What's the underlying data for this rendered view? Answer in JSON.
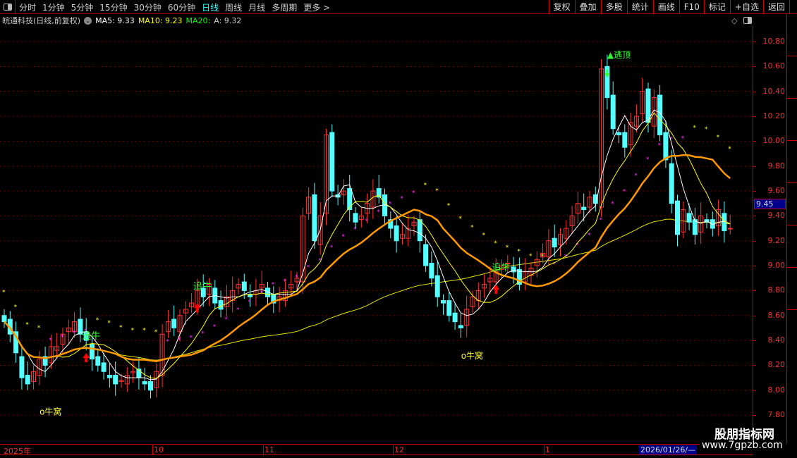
{
  "toolbar": {
    "periods": [
      "分时",
      "1分钟",
      "5分钟",
      "15分钟",
      "30分钟",
      "60分钟",
      "日线",
      "周线",
      "月线",
      "多周期",
      "更多 >"
    ],
    "active_period": "日线",
    "tools": [
      "复权",
      "叠加",
      "多股",
      "统计",
      "画线",
      "F10",
      "标记",
      "+自选",
      "返回"
    ]
  },
  "info": {
    "title": "皖通科技(日线,前复权)",
    "ma5": "MA5: 9.33",
    "ma10": "MA10: 9.23",
    "ma20": "MA20:",
    "a": "A: 9.32"
  },
  "colors": {
    "up": "#ff3333",
    "down": "#54ffff",
    "ma5": "#ffffff",
    "ma10": "#ffff00",
    "ma20": "#ff9900",
    "ma_long": "#e6e600",
    "axis": "#cc0000"
  },
  "price_axis": {
    "labels": [
      "10.80",
      "10.60",
      "10.40",
      "10.20",
      "10.00",
      "9.80",
      "9.60",
      "9.40",
      "9.20",
      "9.00",
      "8.80",
      "8.60",
      "8.40",
      "8.20",
      "8.00",
      "7.80"
    ],
    "current": "9.45"
  },
  "date_axis": {
    "labels": [
      "2025年",
      "10",
      "11",
      "12",
      "1"
    ],
    "selected": "2026/01/26/—"
  },
  "closes": [
    8.55,
    8.45,
    8.3,
    8.1,
    8.05,
    8.15,
    8.25,
    8.2,
    8.35,
    8.35,
    8.45,
    8.5,
    8.55,
    8.45,
    8.4,
    8.25,
    8.2,
    8.15,
    8.1,
    8.05,
    8.08,
    8.12,
    8.15,
    8.1,
    8.05,
    8.0,
    8.15,
    8.45,
    8.55,
    8.5,
    8.6,
    8.65,
    8.7,
    8.8,
    8.75,
    8.85,
    8.7,
    8.65,
    8.75,
    8.8,
    8.85,
    8.8,
    8.75,
    8.8,
    8.85,
    8.75,
    8.7,
    8.75,
    8.8,
    8.85,
    8.9,
    9.4,
    9.55,
    9.2,
    9.4,
    10.05,
    9.6,
    9.55,
    9.6,
    9.45,
    9.35,
    9.4,
    9.5,
    9.6,
    9.55,
    9.4,
    9.3,
    9.2,
    9.25,
    9.3,
    9.35,
    9.2,
    9.0,
    8.9,
    8.75,
    8.7,
    8.6,
    8.55,
    8.5,
    8.65,
    8.75,
    8.8,
    8.85,
    8.9,
    8.95,
    9.0,
    9.02,
    8.95,
    8.85,
    8.95,
    8.98,
    9.05,
    9.1,
    9.2,
    9.15,
    9.25,
    9.3,
    9.4,
    9.5,
    9.45,
    9.55,
    9.5,
    10.58,
    10.35,
    10.1,
    10.05,
    9.95,
    10.15,
    10.2,
    10.4,
    10.15,
    10.35,
    10.05,
    9.85,
    9.5,
    9.25,
    9.45,
    9.35,
    9.25,
    9.4,
    9.35,
    9.3,
    9.45,
    9.28,
    9.3
  ],
  "signals": {
    "chase": {
      "label": "追牛",
      "at": [
        14,
        33,
        84
      ]
    },
    "nest": {
      "label": "牛窝",
      "at": [
        7,
        79
      ]
    },
    "top": {
      "label": "▲逃顶",
      "at": [
        103
      ]
    }
  },
  "watermark": {
    "name": "股朋指标网",
    "url": "www.7gpzb.com"
  }
}
